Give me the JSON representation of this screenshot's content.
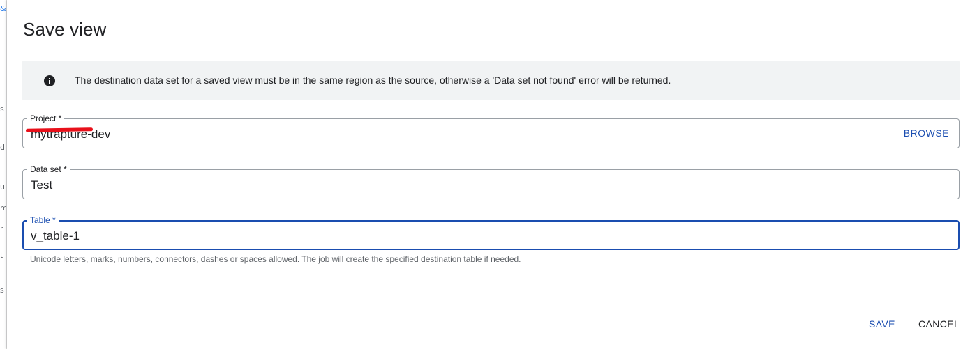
{
  "background_strip": {
    "glyphs": [
      "&",
      "s",
      "d",
      "u",
      "m",
      "r",
      "t",
      "s"
    ]
  },
  "dialog": {
    "title": "Save view",
    "info": {
      "icon": "info-icon",
      "text": "The destination data set for a saved view must be in the same region as the source, otherwise a 'Data set not found' error will be returned."
    },
    "fields": {
      "project": {
        "label": "Project *",
        "value": "mytrapture-dev",
        "value_visible_suffix": "dev",
        "browse_label": "BROWSE"
      },
      "dataset": {
        "label": "Data set *",
        "value": "Test"
      },
      "table": {
        "label": "Table *",
        "value": "v_table-1",
        "hint": "Unicode letters, marks, numbers, connectors, dashes or spaces allowed. The job will create the specified destination table if needed."
      }
    },
    "actions": {
      "save_label": "SAVE",
      "cancel_label": "CANCEL"
    },
    "colors": {
      "accent": "#1a4db0",
      "banner_bg": "#f1f3f4",
      "redaction": "#e8101a"
    }
  }
}
